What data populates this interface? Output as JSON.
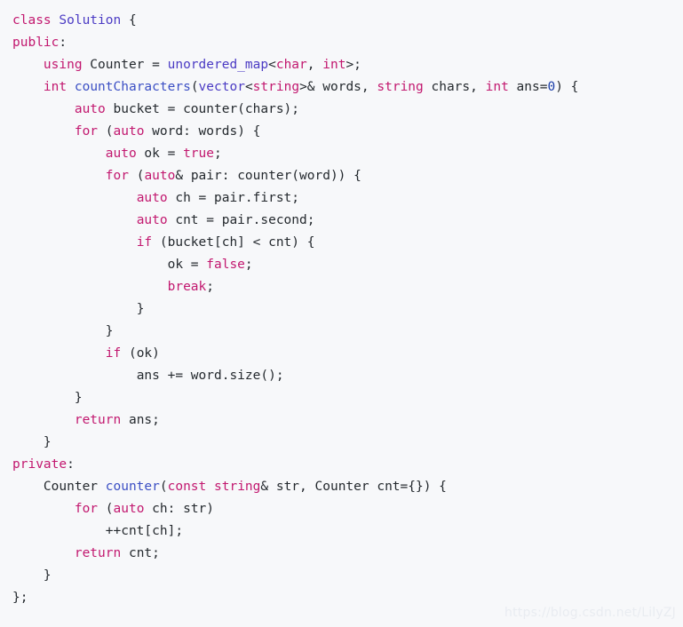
{
  "editor": {
    "language": "cpp",
    "background_color": "#f7f8fa",
    "colors": {
      "keyword": "#c2186f",
      "type": "#4b3bc4",
      "function": "#3b4fc4",
      "number": "#1b3ea8",
      "plain": "#24292e",
      "watermark": "#e9ecf1"
    },
    "watermark": "https://blog.csdn.net/LilyZJ",
    "lines": [
      {
        "indent": 0,
        "tokens": [
          {
            "t": "class",
            "c": "kw"
          },
          {
            "t": " ",
            "c": "plain"
          },
          {
            "t": "Solution",
            "c": "type"
          },
          {
            "t": " {",
            "c": "plain"
          }
        ]
      },
      {
        "indent": 0,
        "tokens": [
          {
            "t": "public",
            "c": "kw"
          },
          {
            "t": ":",
            "c": "plain"
          }
        ]
      },
      {
        "indent": 1,
        "tokens": [
          {
            "t": "using",
            "c": "kw"
          },
          {
            "t": " Counter = ",
            "c": "plain"
          },
          {
            "t": "unordered_map",
            "c": "type"
          },
          {
            "t": "<",
            "c": "plain"
          },
          {
            "t": "char",
            "c": "kw"
          },
          {
            "t": ", ",
            "c": "plain"
          },
          {
            "t": "int",
            "c": "kw"
          },
          {
            "t": ">;",
            "c": "plain"
          }
        ]
      },
      {
        "indent": 1,
        "tokens": [
          {
            "t": "int",
            "c": "kw"
          },
          {
            "t": " ",
            "c": "plain"
          },
          {
            "t": "countCharacters",
            "c": "fn"
          },
          {
            "t": "(",
            "c": "plain"
          },
          {
            "t": "vector",
            "c": "type"
          },
          {
            "t": "<",
            "c": "plain"
          },
          {
            "t": "string",
            "c": "kw"
          },
          {
            "t": ">& words, ",
            "c": "plain"
          },
          {
            "t": "string",
            "c": "kw"
          },
          {
            "t": " chars, ",
            "c": "plain"
          },
          {
            "t": "int",
            "c": "kw"
          },
          {
            "t": " ans=",
            "c": "plain"
          },
          {
            "t": "0",
            "c": "num"
          },
          {
            "t": ") {",
            "c": "plain"
          }
        ]
      },
      {
        "indent": 2,
        "tokens": [
          {
            "t": "auto",
            "c": "kw"
          },
          {
            "t": " bucket = counter(chars);",
            "c": "plain"
          }
        ]
      },
      {
        "indent": 2,
        "tokens": [
          {
            "t": "for",
            "c": "kw"
          },
          {
            "t": " (",
            "c": "plain"
          },
          {
            "t": "auto",
            "c": "kw"
          },
          {
            "t": " word: words) {",
            "c": "plain"
          }
        ]
      },
      {
        "indent": 3,
        "tokens": [
          {
            "t": "auto",
            "c": "kw"
          },
          {
            "t": " ok = ",
            "c": "plain"
          },
          {
            "t": "true",
            "c": "kw"
          },
          {
            "t": ";",
            "c": "plain"
          }
        ]
      },
      {
        "indent": 3,
        "tokens": [
          {
            "t": "for",
            "c": "kw"
          },
          {
            "t": " (",
            "c": "plain"
          },
          {
            "t": "auto",
            "c": "kw"
          },
          {
            "t": "& pair: counter(word)) {",
            "c": "plain"
          }
        ]
      },
      {
        "indent": 4,
        "tokens": [
          {
            "t": "auto",
            "c": "kw"
          },
          {
            "t": " ch = pair.first;",
            "c": "plain"
          }
        ]
      },
      {
        "indent": 4,
        "tokens": [
          {
            "t": "auto",
            "c": "kw"
          },
          {
            "t": " cnt = pair.second;",
            "c": "plain"
          }
        ]
      },
      {
        "indent": 4,
        "tokens": [
          {
            "t": "if",
            "c": "kw"
          },
          {
            "t": " (bucket[ch] < cnt) {",
            "c": "plain"
          }
        ]
      },
      {
        "indent": 5,
        "tokens": [
          {
            "t": "ok = ",
            "c": "plain"
          },
          {
            "t": "false",
            "c": "kw"
          },
          {
            "t": ";",
            "c": "plain"
          }
        ]
      },
      {
        "indent": 5,
        "tokens": [
          {
            "t": "break",
            "c": "kw"
          },
          {
            "t": ";",
            "c": "plain"
          }
        ]
      },
      {
        "indent": 4,
        "tokens": [
          {
            "t": "}",
            "c": "plain"
          }
        ]
      },
      {
        "indent": 3,
        "tokens": [
          {
            "t": "}",
            "c": "plain"
          }
        ]
      },
      {
        "indent": 3,
        "tokens": [
          {
            "t": "if",
            "c": "kw"
          },
          {
            "t": " (ok)",
            "c": "plain"
          }
        ]
      },
      {
        "indent": 4,
        "tokens": [
          {
            "t": "ans += word.size();",
            "c": "plain"
          }
        ]
      },
      {
        "indent": 2,
        "tokens": [
          {
            "t": "}",
            "c": "plain"
          }
        ]
      },
      {
        "indent": 2,
        "tokens": [
          {
            "t": "return",
            "c": "kw"
          },
          {
            "t": " ans;",
            "c": "plain"
          }
        ]
      },
      {
        "indent": 1,
        "tokens": [
          {
            "t": "}",
            "c": "plain"
          }
        ]
      },
      {
        "indent": 0,
        "tokens": [
          {
            "t": "private",
            "c": "kw"
          },
          {
            "t": ":",
            "c": "plain"
          }
        ]
      },
      {
        "indent": 1,
        "tokens": [
          {
            "t": "Counter ",
            "c": "plain"
          },
          {
            "t": "counter",
            "c": "fn"
          },
          {
            "t": "(",
            "c": "plain"
          },
          {
            "t": "const",
            "c": "kw"
          },
          {
            "t": " ",
            "c": "plain"
          },
          {
            "t": "string",
            "c": "kw"
          },
          {
            "t": "& str, Counter cnt={}) {",
            "c": "plain"
          }
        ]
      },
      {
        "indent": 2,
        "tokens": [
          {
            "t": "for",
            "c": "kw"
          },
          {
            "t": " (",
            "c": "plain"
          },
          {
            "t": "auto",
            "c": "kw"
          },
          {
            "t": " ch: str)",
            "c": "plain"
          }
        ]
      },
      {
        "indent": 3,
        "tokens": [
          {
            "t": "++cnt[ch];",
            "c": "plain"
          }
        ]
      },
      {
        "indent": 2,
        "tokens": [
          {
            "t": "return",
            "c": "kw"
          },
          {
            "t": " cnt;",
            "c": "plain"
          }
        ]
      },
      {
        "indent": 1,
        "tokens": [
          {
            "t": "}",
            "c": "plain"
          }
        ]
      },
      {
        "indent": 0,
        "tokens": [
          {
            "t": "};",
            "c": "plain"
          }
        ]
      }
    ]
  }
}
